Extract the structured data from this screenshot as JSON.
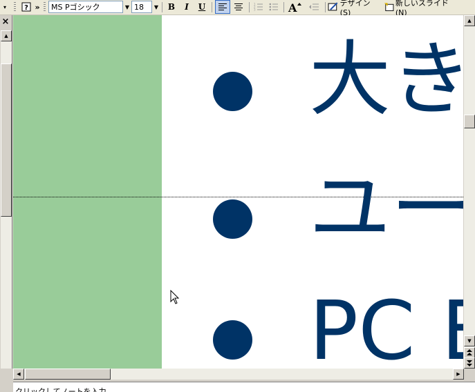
{
  "toolbar": {
    "help_icon": "help-icon",
    "overflow_1": "»",
    "font_name": "MS Pゴシック",
    "font_size": "18",
    "bold_label": "B",
    "italic_label": "I",
    "underline_label": "U",
    "design_label": "デザイン(S)",
    "new_slide_label": "新しいスライド(N)"
  },
  "slide": {
    "line1": "大き",
    "line2": "ユー",
    "line3": "PC E",
    "bullet_color": "#003366",
    "panel_color": "#99cc99"
  },
  "outline_close": "×",
  "notes": {
    "placeholder": "クリックしてノートを入力"
  }
}
